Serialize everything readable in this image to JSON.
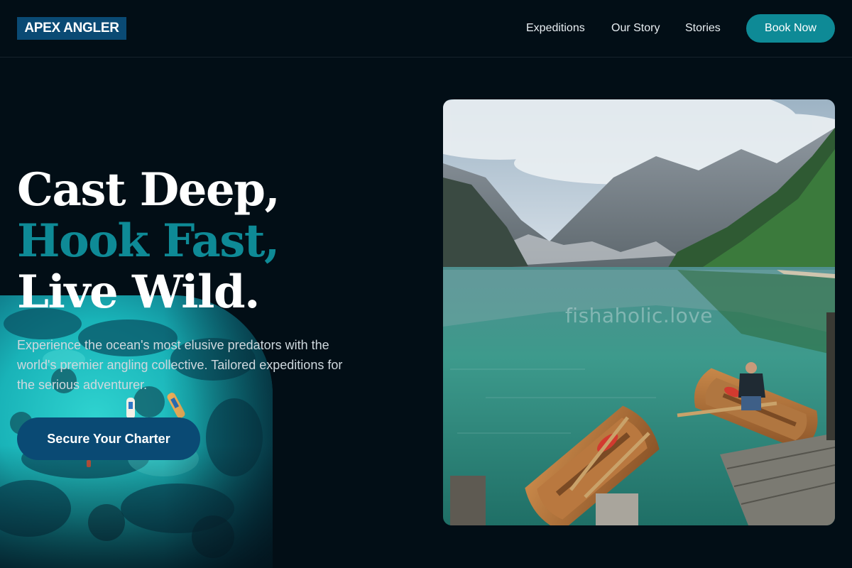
{
  "brand": {
    "name": "APEX ANGLER"
  },
  "nav": {
    "links": [
      "Expeditions",
      "Our Story",
      "Stories"
    ],
    "cta_label": "Book Now"
  },
  "hero": {
    "headline_lines": [
      "Cast Deep,",
      "Hook Fast,",
      "Live Wild."
    ],
    "subcopy": "Experience the ocean's most elusive predators with the world's premier angling collective. Tailored expeditions for the serious adventurer.",
    "cta_label": "Secure Your Charter"
  },
  "photo": {
    "watermark": "fishaholic.love"
  },
  "colors": {
    "background": "#020e16",
    "brand_blue": "#0a4a74",
    "accent_teal": "#0e8a96",
    "text_white": "#ffffff"
  },
  "icons": {
    "reef_image": "aerial-reef-boats-photo",
    "lake_image": "mountain-lake-rowboats-photo"
  }
}
